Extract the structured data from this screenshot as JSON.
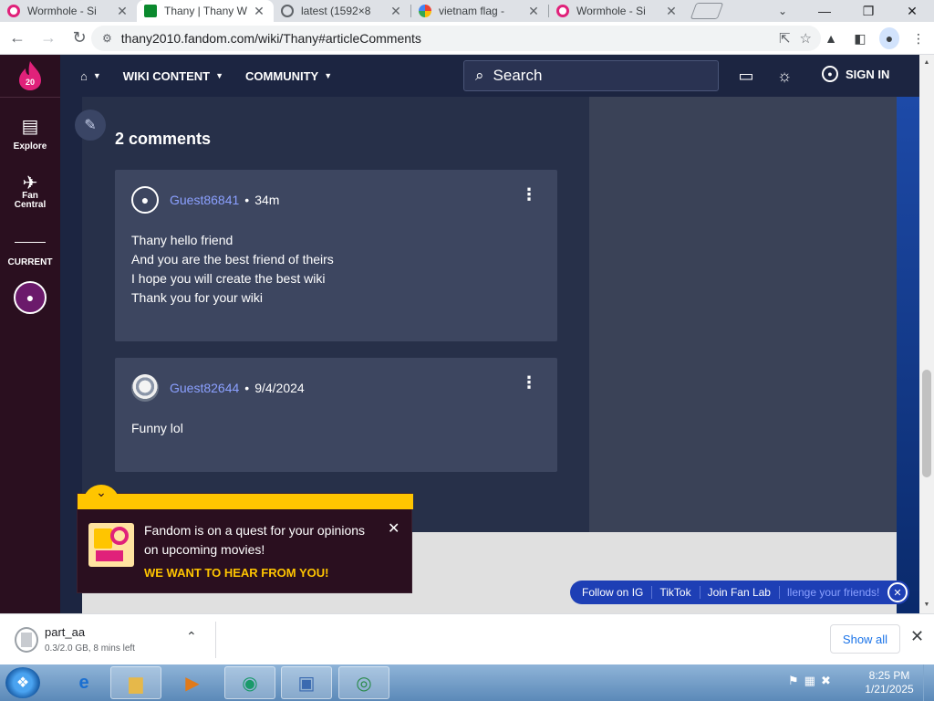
{
  "browser": {
    "tabs": [
      {
        "title": "Wormhole - Si",
        "active": false,
        "favicon_color": "#e0217a"
      },
      {
        "title": "Thany | Thany W",
        "active": true,
        "favicon_color": "#0b8a2e"
      },
      {
        "title": "latest (1592×8",
        "active": false,
        "favicon_color": "#5f6368"
      },
      {
        "title": "vietnam flag - ",
        "active": false,
        "favicon_color": "#4285f4"
      },
      {
        "title": "Wormhole - Si",
        "active": false,
        "favicon_color": "#e0217a"
      }
    ],
    "url": "thany2010.fandom.com/wiki/Thany#articleComments"
  },
  "site": {
    "rail": {
      "logo_text": "20",
      "explore_label": "Explore",
      "fan_central_label": "Fan Central",
      "current_label": "CURRENT"
    },
    "nav": {
      "wiki_content_label": "WIKI CONTENT",
      "community_label": "COMMUNITY",
      "search_placeholder": "Search",
      "sign_in_label": "SIGN IN"
    },
    "comments": {
      "title": "2 comments",
      "items": [
        {
          "user": "Guest86841",
          "time": "34m",
          "lines": [
            "Thany hello friend",
            "And you are the best friend of theirs",
            "I hope you will create the best wiki",
            "Thank you for your wiki"
          ]
        },
        {
          "user": "Guest82644",
          "time": "9/4/2024",
          "lines": [
            "Funny lol"
          ]
        }
      ]
    },
    "quest_banner": {
      "text": "Fandom is on a quest for your opinions on upcoming movies!",
      "cta": "WE WANT TO HEAR FROM YOU!"
    },
    "follow_bar": {
      "items": [
        "Follow on IG",
        "TikTok",
        "Join Fan Lab"
      ],
      "faded": "llenge your friends!"
    }
  },
  "downloads": {
    "file_name": "part_aa",
    "status": "0.3/2.0 GB, 8 mins left",
    "show_all_label": "Show all"
  },
  "taskbar": {
    "time": "8:25 PM",
    "date": "1/21/2025"
  },
  "colors": {
    "fandom_dark": "#2a0f1f",
    "page_bg": "#1c2541",
    "accent_yellow": "#ffc500",
    "username_link": "#8ba0ff"
  }
}
